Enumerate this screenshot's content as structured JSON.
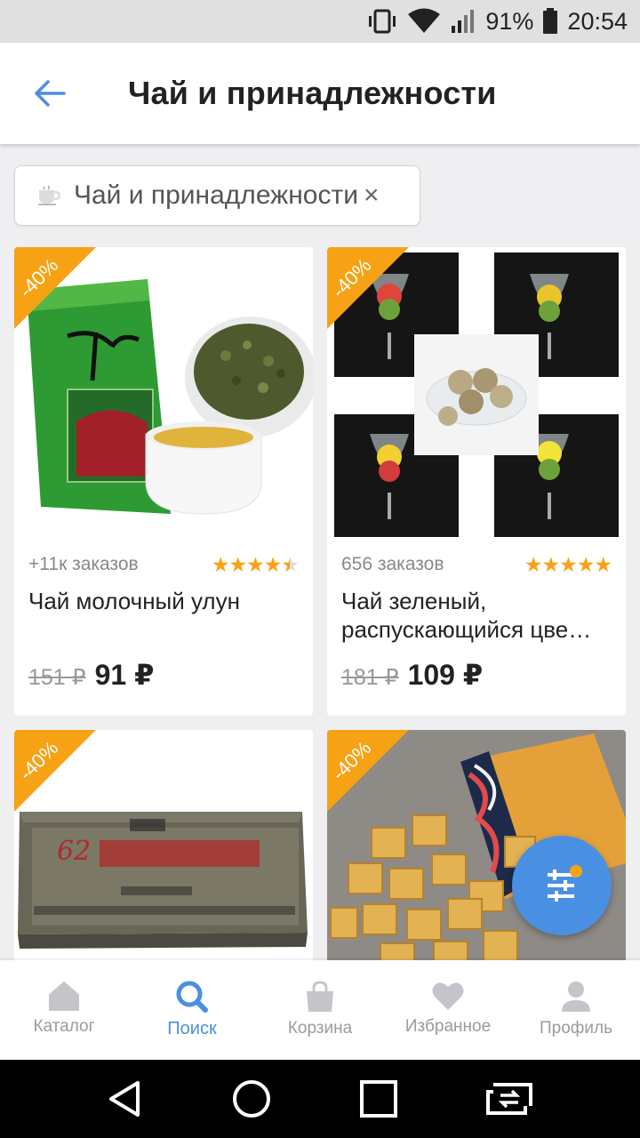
{
  "status_bar": {
    "battery": "91%",
    "time": "20:54"
  },
  "header": {
    "title": "Чай и принадлежности",
    "back_icon": "arrow-back-icon"
  },
  "filter_chip": {
    "label": "Чай и принадлежности",
    "close": "×",
    "icon": "tea-cup-icon"
  },
  "products": [
    {
      "discount": "-40%",
      "orders": "+11к заказов",
      "rating": 4.5,
      "name": "Чай молочный улун",
      "old_price": "151 ₽",
      "price": "91 ₽"
    },
    {
      "discount": "-40%",
      "orders": "656 заказов",
      "rating": 5,
      "name": "Чай зеленый, распускающийся цве…",
      "old_price": "181 ₽",
      "price": "109 ₽"
    },
    {
      "discount": "-40%"
    },
    {
      "discount": "-40%"
    }
  ],
  "fab": {
    "icon": "filter-sliders-icon"
  },
  "bottom_nav": [
    {
      "label": "Каталог",
      "icon": "home-icon",
      "active": false
    },
    {
      "label": "Поиск",
      "icon": "search-icon",
      "active": true
    },
    {
      "label": "Корзина",
      "icon": "bag-icon",
      "active": false
    },
    {
      "label": "Избранное",
      "icon": "heart-icon",
      "active": false
    },
    {
      "label": "Профиль",
      "icon": "person-icon",
      "active": false
    }
  ],
  "colors": {
    "accent": "#4a90e2",
    "badge": "#f7a215",
    "stars": "#f7a215"
  }
}
